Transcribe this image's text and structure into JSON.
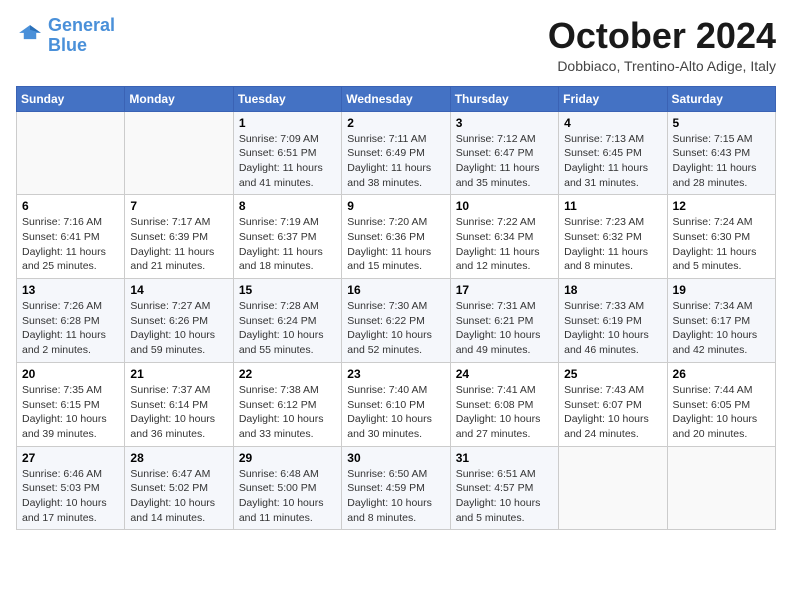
{
  "header": {
    "logo_line1": "General",
    "logo_line2": "Blue",
    "month": "October 2024",
    "location": "Dobbiaco, Trentino-Alto Adige, Italy"
  },
  "weekdays": [
    "Sunday",
    "Monday",
    "Tuesday",
    "Wednesday",
    "Thursday",
    "Friday",
    "Saturday"
  ],
  "weeks": [
    [
      {
        "day": null
      },
      {
        "day": null
      },
      {
        "day": "1",
        "sunrise": "Sunrise: 7:09 AM",
        "sunset": "Sunset: 6:51 PM",
        "daylight": "Daylight: 11 hours and 41 minutes."
      },
      {
        "day": "2",
        "sunrise": "Sunrise: 7:11 AM",
        "sunset": "Sunset: 6:49 PM",
        "daylight": "Daylight: 11 hours and 38 minutes."
      },
      {
        "day": "3",
        "sunrise": "Sunrise: 7:12 AM",
        "sunset": "Sunset: 6:47 PM",
        "daylight": "Daylight: 11 hours and 35 minutes."
      },
      {
        "day": "4",
        "sunrise": "Sunrise: 7:13 AM",
        "sunset": "Sunset: 6:45 PM",
        "daylight": "Daylight: 11 hours and 31 minutes."
      },
      {
        "day": "5",
        "sunrise": "Sunrise: 7:15 AM",
        "sunset": "Sunset: 6:43 PM",
        "daylight": "Daylight: 11 hours and 28 minutes."
      }
    ],
    [
      {
        "day": "6",
        "sunrise": "Sunrise: 7:16 AM",
        "sunset": "Sunset: 6:41 PM",
        "daylight": "Daylight: 11 hours and 25 minutes."
      },
      {
        "day": "7",
        "sunrise": "Sunrise: 7:17 AM",
        "sunset": "Sunset: 6:39 PM",
        "daylight": "Daylight: 11 hours and 21 minutes."
      },
      {
        "day": "8",
        "sunrise": "Sunrise: 7:19 AM",
        "sunset": "Sunset: 6:37 PM",
        "daylight": "Daylight: 11 hours and 18 minutes."
      },
      {
        "day": "9",
        "sunrise": "Sunrise: 7:20 AM",
        "sunset": "Sunset: 6:36 PM",
        "daylight": "Daylight: 11 hours and 15 minutes."
      },
      {
        "day": "10",
        "sunrise": "Sunrise: 7:22 AM",
        "sunset": "Sunset: 6:34 PM",
        "daylight": "Daylight: 11 hours and 12 minutes."
      },
      {
        "day": "11",
        "sunrise": "Sunrise: 7:23 AM",
        "sunset": "Sunset: 6:32 PM",
        "daylight": "Daylight: 11 hours and 8 minutes."
      },
      {
        "day": "12",
        "sunrise": "Sunrise: 7:24 AM",
        "sunset": "Sunset: 6:30 PM",
        "daylight": "Daylight: 11 hours and 5 minutes."
      }
    ],
    [
      {
        "day": "13",
        "sunrise": "Sunrise: 7:26 AM",
        "sunset": "Sunset: 6:28 PM",
        "daylight": "Daylight: 11 hours and 2 minutes."
      },
      {
        "day": "14",
        "sunrise": "Sunrise: 7:27 AM",
        "sunset": "Sunset: 6:26 PM",
        "daylight": "Daylight: 10 hours and 59 minutes."
      },
      {
        "day": "15",
        "sunrise": "Sunrise: 7:28 AM",
        "sunset": "Sunset: 6:24 PM",
        "daylight": "Daylight: 10 hours and 55 minutes."
      },
      {
        "day": "16",
        "sunrise": "Sunrise: 7:30 AM",
        "sunset": "Sunset: 6:22 PM",
        "daylight": "Daylight: 10 hours and 52 minutes."
      },
      {
        "day": "17",
        "sunrise": "Sunrise: 7:31 AM",
        "sunset": "Sunset: 6:21 PM",
        "daylight": "Daylight: 10 hours and 49 minutes."
      },
      {
        "day": "18",
        "sunrise": "Sunrise: 7:33 AM",
        "sunset": "Sunset: 6:19 PM",
        "daylight": "Daylight: 10 hours and 46 minutes."
      },
      {
        "day": "19",
        "sunrise": "Sunrise: 7:34 AM",
        "sunset": "Sunset: 6:17 PM",
        "daylight": "Daylight: 10 hours and 42 minutes."
      }
    ],
    [
      {
        "day": "20",
        "sunrise": "Sunrise: 7:35 AM",
        "sunset": "Sunset: 6:15 PM",
        "daylight": "Daylight: 10 hours and 39 minutes."
      },
      {
        "day": "21",
        "sunrise": "Sunrise: 7:37 AM",
        "sunset": "Sunset: 6:14 PM",
        "daylight": "Daylight: 10 hours and 36 minutes."
      },
      {
        "day": "22",
        "sunrise": "Sunrise: 7:38 AM",
        "sunset": "Sunset: 6:12 PM",
        "daylight": "Daylight: 10 hours and 33 minutes."
      },
      {
        "day": "23",
        "sunrise": "Sunrise: 7:40 AM",
        "sunset": "Sunset: 6:10 PM",
        "daylight": "Daylight: 10 hours and 30 minutes."
      },
      {
        "day": "24",
        "sunrise": "Sunrise: 7:41 AM",
        "sunset": "Sunset: 6:08 PM",
        "daylight": "Daylight: 10 hours and 27 minutes."
      },
      {
        "day": "25",
        "sunrise": "Sunrise: 7:43 AM",
        "sunset": "Sunset: 6:07 PM",
        "daylight": "Daylight: 10 hours and 24 minutes."
      },
      {
        "day": "26",
        "sunrise": "Sunrise: 7:44 AM",
        "sunset": "Sunset: 6:05 PM",
        "daylight": "Daylight: 10 hours and 20 minutes."
      }
    ],
    [
      {
        "day": "27",
        "sunrise": "Sunrise: 6:46 AM",
        "sunset": "Sunset: 5:03 PM",
        "daylight": "Daylight: 10 hours and 17 minutes."
      },
      {
        "day": "28",
        "sunrise": "Sunrise: 6:47 AM",
        "sunset": "Sunset: 5:02 PM",
        "daylight": "Daylight: 10 hours and 14 minutes."
      },
      {
        "day": "29",
        "sunrise": "Sunrise: 6:48 AM",
        "sunset": "Sunset: 5:00 PM",
        "daylight": "Daylight: 10 hours and 11 minutes."
      },
      {
        "day": "30",
        "sunrise": "Sunrise: 6:50 AM",
        "sunset": "Sunset: 4:59 PM",
        "daylight": "Daylight: 10 hours and 8 minutes."
      },
      {
        "day": "31",
        "sunrise": "Sunrise: 6:51 AM",
        "sunset": "Sunset: 4:57 PM",
        "daylight": "Daylight: 10 hours and 5 minutes."
      },
      {
        "day": null
      },
      {
        "day": null
      }
    ]
  ]
}
